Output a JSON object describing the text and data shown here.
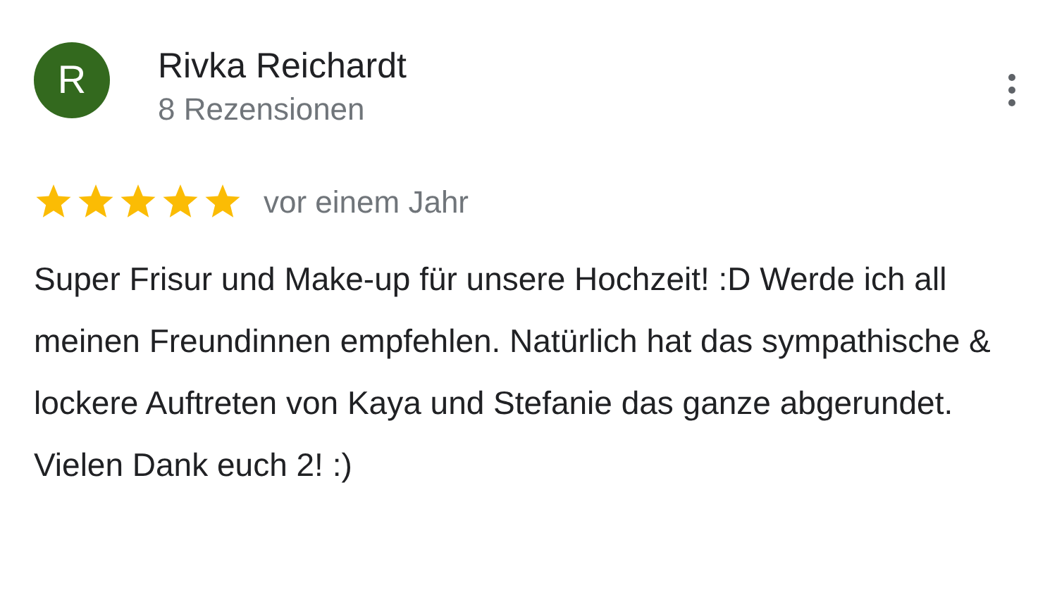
{
  "review": {
    "avatar_letter": "R",
    "author": "Rivka Reichardt",
    "reviews_count": "8 Rezensionen",
    "stars": 5,
    "date": "vor einem Jahr",
    "text": "Super Frisur und Make-up für unsere Hochzeit! :D Werde ich all meinen Freundinnen empfehlen. Natürlich hat das sympathische & lockere Auftreten von Kaya und Stefanie das ganze abgerundet. Vielen Dank euch 2! :)"
  }
}
